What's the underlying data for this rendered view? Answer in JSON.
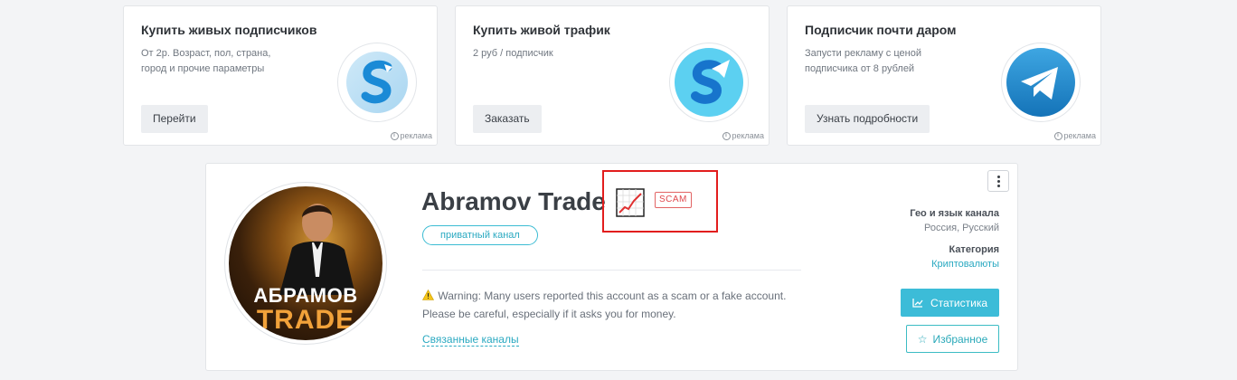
{
  "ads": [
    {
      "title": "Купить живых подписчиков",
      "desc": "От 2р. Возраст, пол, страна, город и прочие параметры",
      "button": "Перейти",
      "note": "реклама",
      "logo": "s-letter-logo"
    },
    {
      "title": "Купить живой трафик",
      "desc": "2 руб / подписчик",
      "button": "Заказать",
      "note": "реклама",
      "logo": "s-paperplane-logo"
    },
    {
      "title": "Подписчик почти даром",
      "desc": "Запусти рекламу с ценой подписчика от 8 рублей",
      "button": "Узнать подробности",
      "note": "реклама",
      "logo": "telegram-logo"
    }
  ],
  "channel": {
    "title": "Abramov Trade",
    "avatar_line1": "АБРАМОВ",
    "avatar_line2": "TRADE",
    "scam_badge": "SCAM",
    "private_label": "приватный канал",
    "warning_line1": "Warning: Many users reported this account as a scam or a fake account.",
    "warning_line2": "Please be careful, especially if it asks you for money.",
    "related_link": "Связанные каналы",
    "geo_label": "Гео и язык канала",
    "geo_value": "Россия, Русский",
    "category_label": "Категория",
    "category_value": "Криптовалюты",
    "stats_button": "Статистика",
    "fav_button": "Избранное"
  },
  "colors": {
    "accent": "#3cbcd8",
    "scam": "#e0474c",
    "highlight": "#e21d1d"
  }
}
